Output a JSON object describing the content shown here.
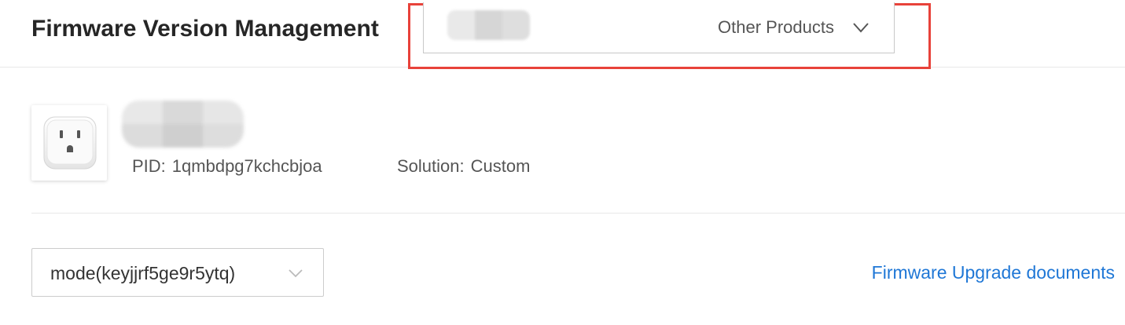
{
  "header": {
    "title": "Firmware Version Management",
    "product_selector": {
      "value": "Other Products",
      "icon": "chevron-down-icon"
    },
    "highlight_color": "#e8423a"
  },
  "product": {
    "image_icon": "smart-plug-icon",
    "pid_label": "PID:",
    "pid_value": "1qmbdpg7kchcbjoa",
    "solution_label": "Solution:",
    "solution_value": "Custom"
  },
  "mode_selector": {
    "value": "mode(keyjjrf5ge9r5ytq)",
    "icon": "chevron-down-icon"
  },
  "docs_link": {
    "label": "Firmware Upgrade documents",
    "color": "#1f77d6"
  }
}
